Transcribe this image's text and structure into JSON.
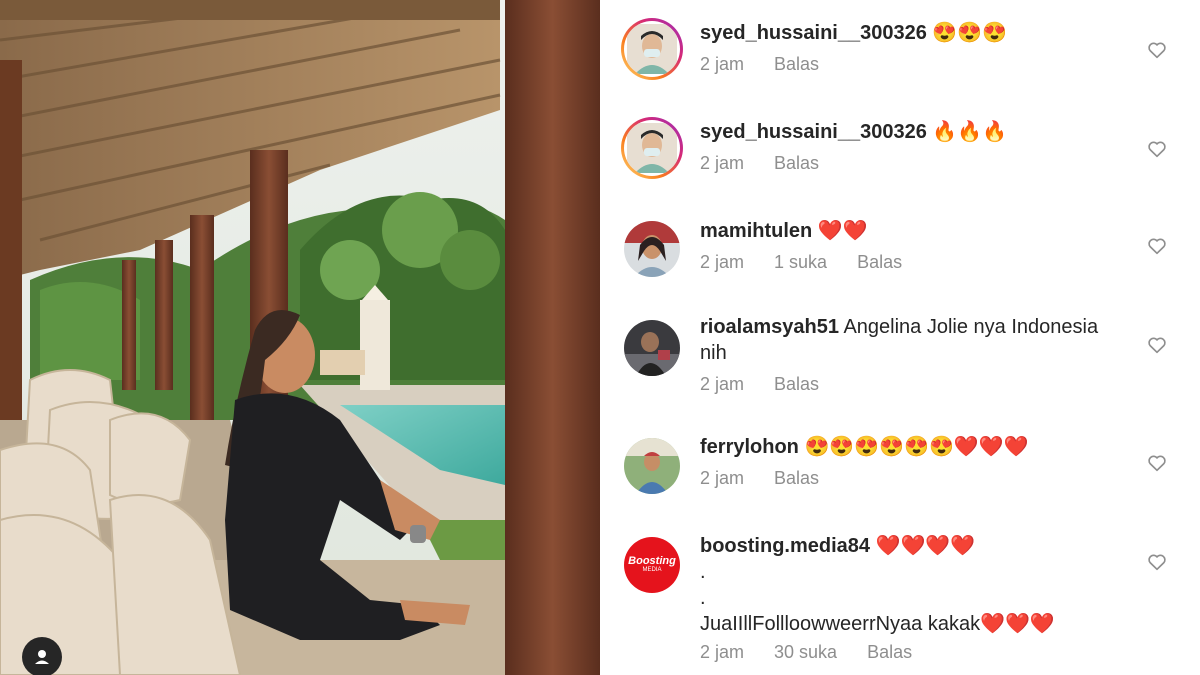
{
  "comments": [
    {
      "username": "syed_hussaini__300326",
      "text": "😍😍😍",
      "time": "2 jam",
      "likes": "",
      "reply": "Balas",
      "avatar": "user-selfie-avatar"
    },
    {
      "username": "syed_hussaini__300326",
      "text": "🔥🔥🔥",
      "time": "2 jam",
      "likes": "",
      "reply": "Balas",
      "avatar": "user-selfie-avatar"
    },
    {
      "username": "mamihtulen",
      "text": "❤️❤️",
      "time": "2 jam",
      "likes": "1 suka",
      "reply": "Balas",
      "avatar": "woman-avatar"
    },
    {
      "username": "rioalamsyah51",
      "text": "Angelina Jolie nya Indonesia nih",
      "time": "2 jam",
      "likes": "",
      "reply": "Balas",
      "avatar": "man-avatar"
    },
    {
      "username": "ferrylohon",
      "text": "😍😍😍😍😍😍❤️❤️❤️",
      "time": "2 jam",
      "likes": "",
      "reply": "Balas",
      "avatar": "man-outdoor-avatar"
    },
    {
      "username": "boosting.media84",
      "text": "❤️❤️❤️❤️",
      "line2": ".",
      "line3": ".",
      "line4": "JuaIIllFollloowweerrNyaa kakak❤️❤️❤️",
      "time": "2 jam",
      "likes": "30 suka",
      "reply": "Balas",
      "avatar": "boosting-media-logo",
      "logo_text": "Boosting",
      "logo_sub": "MEDIA"
    }
  ],
  "colors": {
    "logo_red": "#e5131c",
    "muted": "#8e8e8e"
  }
}
